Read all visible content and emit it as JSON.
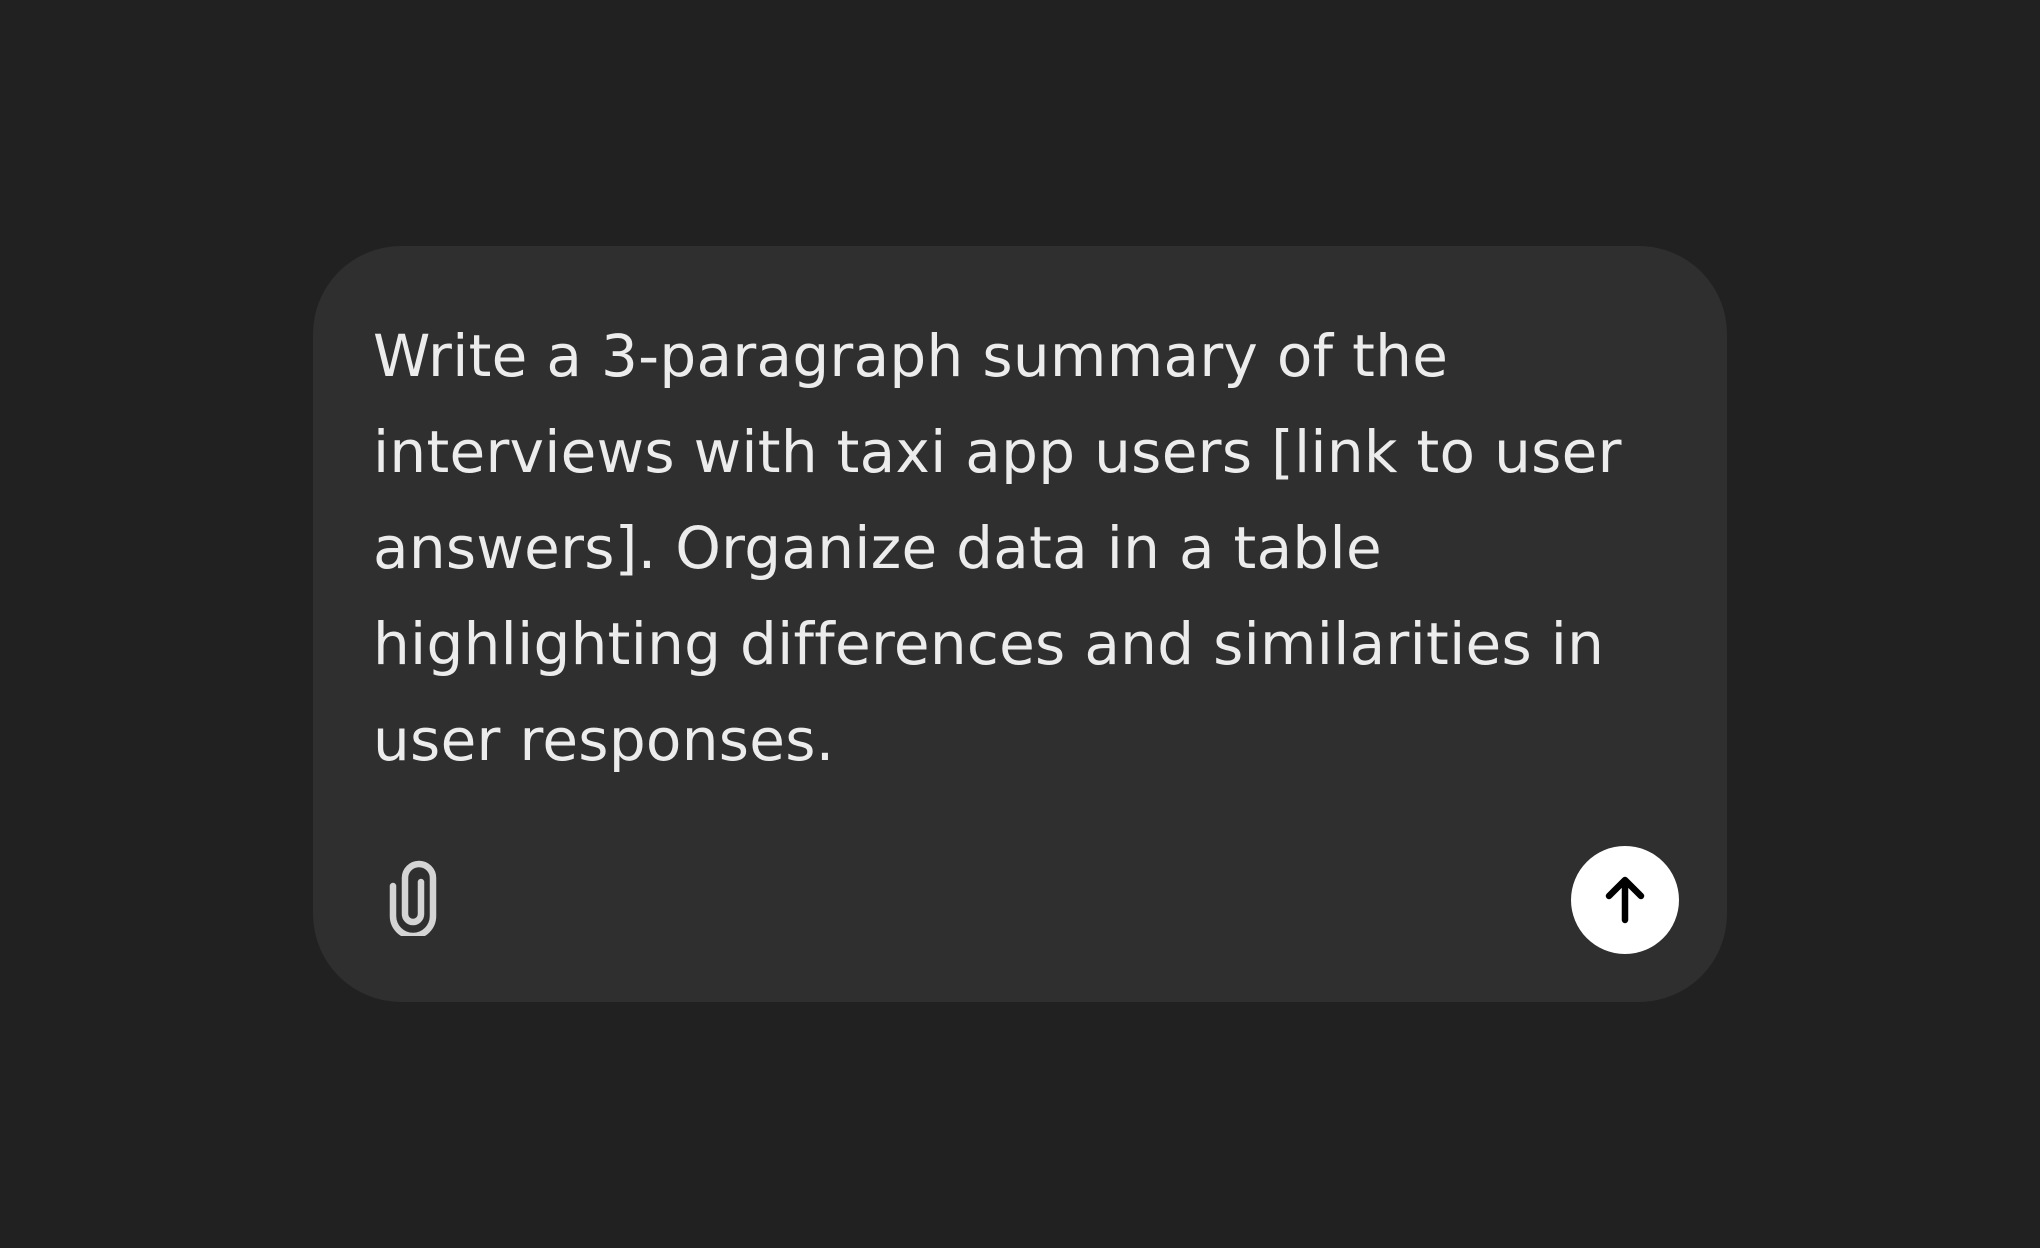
{
  "composer": {
    "prompt_text": "Write a 3-paragraph summary of the interviews with taxi app users [link to user answers]. Organize data in a table highlighting differences and similarities in user responses.",
    "attach_icon": "paperclip-icon",
    "send_icon": "arrow-up-icon"
  },
  "colors": {
    "page_background": "#212121",
    "composer_background": "#2f2f2f",
    "text": "#ececec",
    "attach_icon": "#d4d4d4",
    "send_button_background": "#ffffff",
    "send_icon": "#000000"
  }
}
